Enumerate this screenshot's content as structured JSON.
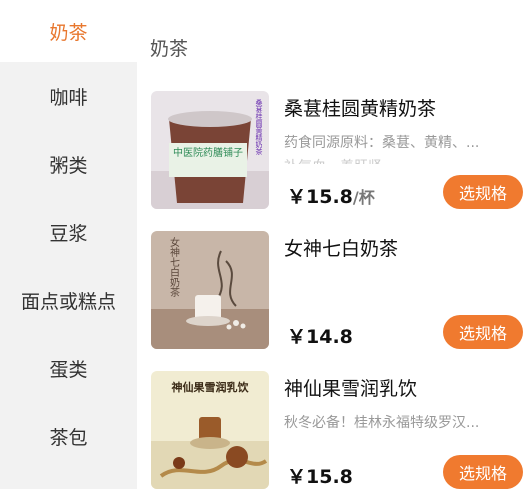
{
  "sidebar": {
    "items": [
      {
        "label": "奶茶"
      },
      {
        "label": "咖啡"
      },
      {
        "label": "粥类"
      },
      {
        "label": "豆浆"
      },
      {
        "label": "面点或糕点"
      },
      {
        "label": "蛋类"
      },
      {
        "label": "茶包"
      }
    ]
  },
  "main": {
    "section_title": "奶茶",
    "products": [
      {
        "name": "桑葚桂圆黄精奶茶",
        "desc": "药食同源原料：桑葚、黄精、...",
        "desc2": "补气血、养肝肾",
        "price": "￥15.8",
        "unit": "/杯",
        "button": "选规格",
        "image_text": "中医院药膳铺子",
        "image_side_text": "桑葚桂圆黄精奶茶"
      },
      {
        "name": "女神七白奶茶",
        "desc": "",
        "price": "￥14.8",
        "unit": "",
        "button": "选规格",
        "image_text": "女神七白奶茶"
      },
      {
        "name": "神仙果雪润乳饮",
        "desc": "秋冬必备！桂林永福特级罗汉...",
        "price": "￥15.8",
        "unit": "",
        "button": "选规格",
        "image_text": "神仙果雪润乳饮"
      }
    ]
  },
  "colors": {
    "accent": "#e8772e",
    "button_bg": "#f07a2f",
    "sidebar_bg": "#f2f2f2"
  }
}
